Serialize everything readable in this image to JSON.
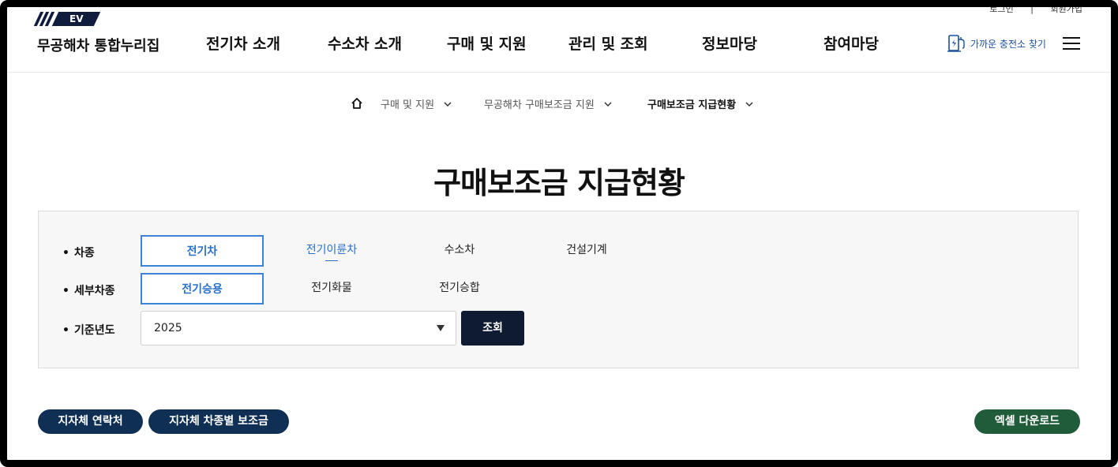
{
  "header": {
    "util": [
      "로그인",
      "|",
      "회원가입"
    ],
    "logo_badge": "EV",
    "site_name": "무공해차 통합누리집",
    "nav": [
      "전기차 소개",
      "수소차 소개",
      "구매 및 지원",
      "관리 및 조회",
      "정보마당",
      "참여마당"
    ],
    "find_station": "가까운 충전소 찾기"
  },
  "breadcrumb": [
    "구매 및 지원",
    "무공해차 구매보조금 지원",
    "구매보조금 지급현황"
  ],
  "page_title": "구매보조금 지급현황",
  "filters": {
    "vehicle_type": {
      "label": "차종",
      "options": [
        "전기차",
        "전기이륜차",
        "수소차",
        "건설기계"
      ],
      "selected": "전기차"
    },
    "sub_type": {
      "label": "세부차종",
      "options": [
        "전기승용",
        "전기화물",
        "전기승합"
      ],
      "selected": "전기승용"
    },
    "year": {
      "label": "기준년도",
      "value": "2025"
    },
    "search_label": "조회"
  },
  "actions": {
    "contacts": "지자체 연락처",
    "subsidy_by_type": "지자체 차종별 보조금",
    "excel": "엑셀 다운로드"
  },
  "colors": {
    "navy": "#0f1a33",
    "accent_blue": "#2a6fc9",
    "excel_green": "#215c3a"
  }
}
